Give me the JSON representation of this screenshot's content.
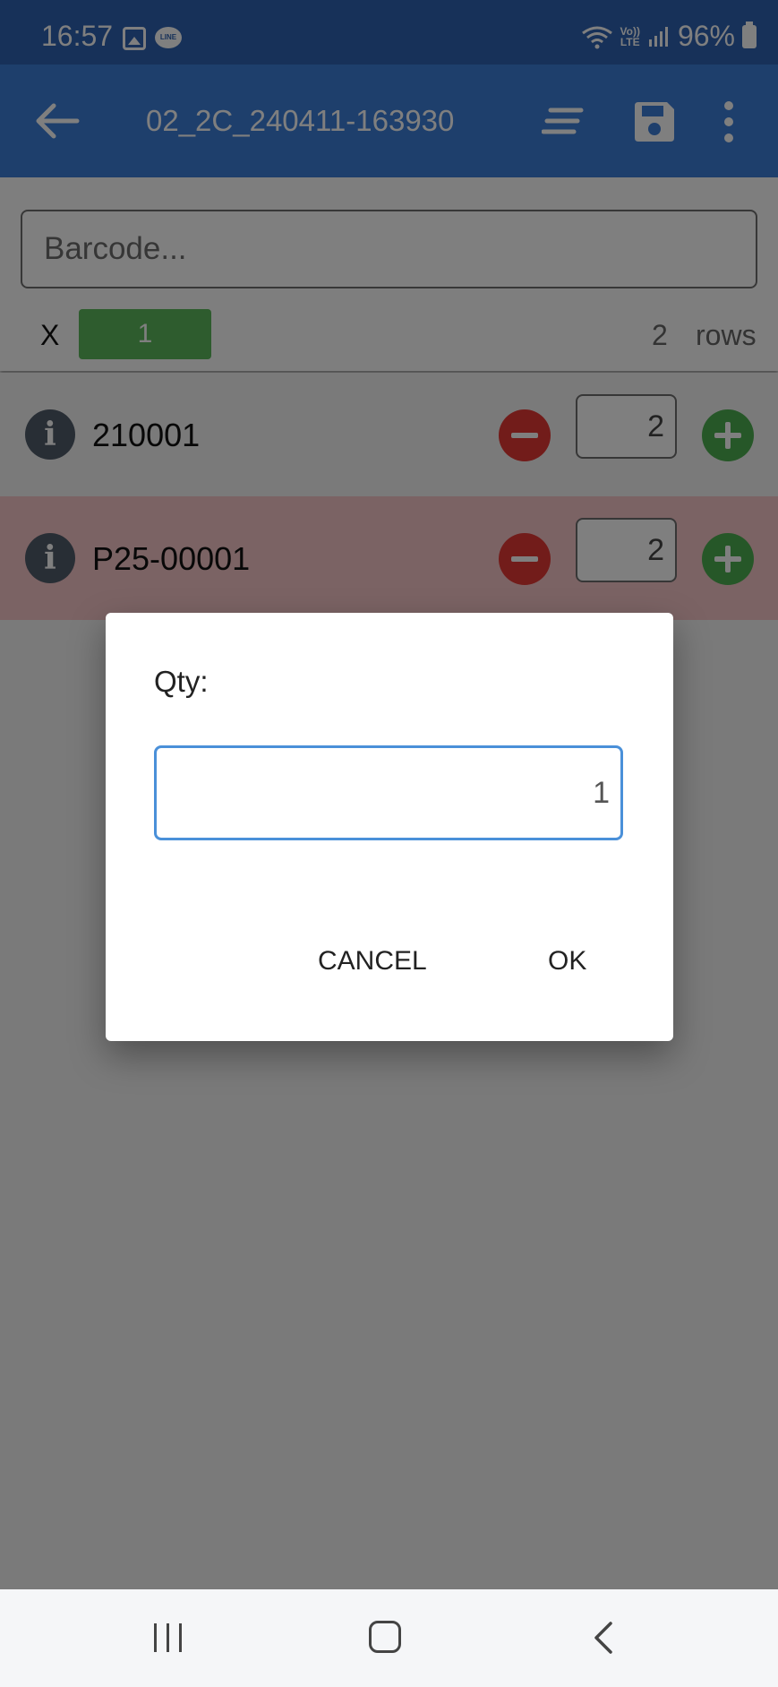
{
  "status_bar": {
    "time": "16:57",
    "line_badge": "LINE",
    "volte_top": "Vo))",
    "volte_bottom": "LTE",
    "battery": "96%"
  },
  "app_bar": {
    "title": "02_2C_240411-163930",
    "icons": [
      "back-arrow",
      "sort-lines",
      "save-floppy",
      "more-vertical"
    ]
  },
  "scan_panel": {
    "barcode_placeholder": "Barcode...",
    "multiplier_label": "X",
    "multiplier_value": "1",
    "row_count": "2",
    "row_count_label": "rows"
  },
  "items": [
    {
      "code": "210001",
      "qty": "2",
      "info": "i",
      "highlight": false
    },
    {
      "code": "P25-00001",
      "qty": "2",
      "info": "i",
      "highlight": true
    }
  ],
  "dialog": {
    "label": "Qty:",
    "value": "1",
    "cancel_label": "CANCEL",
    "ok_label": "OK"
  },
  "colors": {
    "app_bar": "#3d7fd9",
    "status_bar": "#2f63b2",
    "minus": "#e53935",
    "plus": "#4caf50",
    "multiplier_bg": "#5cb85c",
    "highlight_row": "#f6c6c9",
    "dialog_input_border": "#4a90d9"
  }
}
